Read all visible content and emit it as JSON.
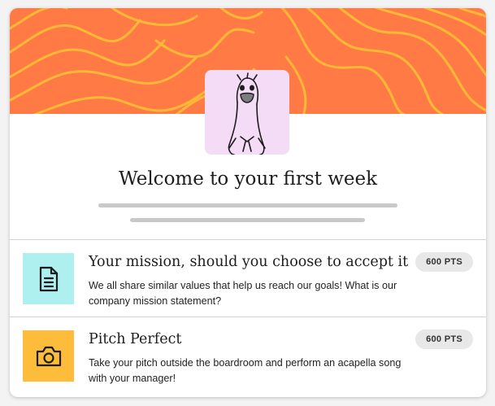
{
  "banner": {
    "color": "#ff7a45",
    "wave_color": "#fcb937"
  },
  "avatar": {
    "icon": "goose-illustration",
    "bg_color": "#f5dcf6"
  },
  "header": {
    "title": "Welcome to your first week"
  },
  "tasks": [
    {
      "icon": "document-icon",
      "tile_color": "#aeeff0",
      "title": "Your mission, should you choose to accept it",
      "description": "We all share similar values that help us reach our goals! What is our company mission statement?",
      "points": "600 PTS"
    },
    {
      "icon": "camera-icon",
      "tile_color": "#fdbc3a",
      "title": "Pitch Perfect",
      "description": "Take your pitch outside the boardroom and perform an acapella song with your manager!",
      "points": "600 PTS"
    }
  ]
}
